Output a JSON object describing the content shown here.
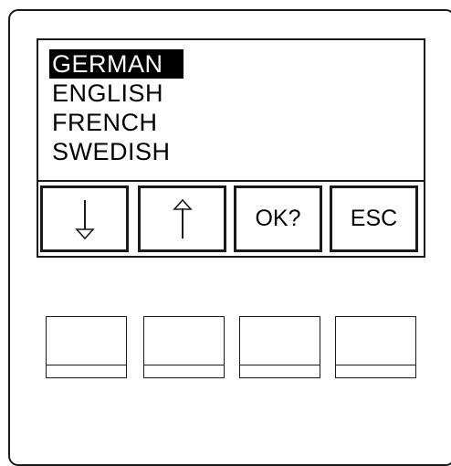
{
  "display": {
    "menu": {
      "selected_index": 0,
      "items": [
        {
          "label": "GERMAN"
        },
        {
          "label": "ENGLISH"
        },
        {
          "label": "FRENCH"
        },
        {
          "label": "SWEDISH"
        }
      ]
    },
    "softkeys": [
      {
        "icon": "arrow-down-icon"
      },
      {
        "icon": "arrow-up-icon"
      },
      {
        "label": "OK?"
      },
      {
        "label": "ESC"
      }
    ]
  }
}
